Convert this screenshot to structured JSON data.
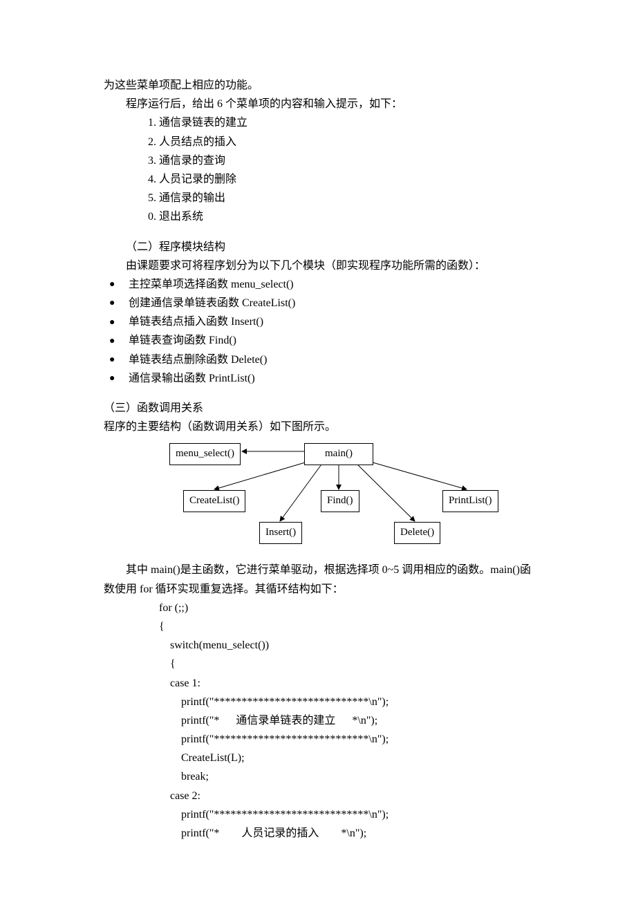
{
  "intro": "为这些菜单项配上相应的功能。",
  "runPrompt": "程序运行后，给出 6 个菜单项的内容和输入提示，如下：",
  "menu": [
    "1. 通信录链表的建立",
    "2. 人员结点的插入",
    "3. 通信录的查询",
    "4. 人员记录的删除",
    "5. 通信录的输出",
    "0. 退出系统"
  ],
  "sec2Title": "（二）程序模块结构",
  "sec2Intro": "由课题要求可将程序划分为以下几个模块（即实现程序功能所需的函数）：",
  "modules": [
    "主控菜单项选择函数 menu_select()",
    "创建通信录单链表函数  CreateList()",
    "单链表结点插入函数  Insert()",
    "单链表查询函数 Find()",
    "单链表结点删除函数 Delete()",
    "通信录输出函数 PrintList()"
  ],
  "sec3Title": "（三）函数调用关系",
  "sec3Intro": "程序的主要结构（函数调用关系）如下图所示。",
  "diagram": {
    "main": "main()",
    "menu": "menu_select()",
    "create": "CreateList()",
    "find": "Find()",
    "print": "PrintList()",
    "insert": "Insert()",
    "delete": "Delete()"
  },
  "afterDiagram": "其中 main()是主函数，它进行菜单驱动，根据选择项 0~5 调用相应的函数。main()函数使用 for 循环实现重复选择。其循环结构如下：",
  "code": "for (;;)\n{\n    switch(menu_select())\n    {\n    case 1:\n        printf(\"****************************\\n\");\n        printf(\"*      通信录单链表的建立      *\\n\");\n        printf(\"****************************\\n\");\n        CreateList(L);\n        break;\n    case 2:\n        printf(\"****************************\\n\");\n        printf(\"*        人员记录的插入        *\\n\");"
}
